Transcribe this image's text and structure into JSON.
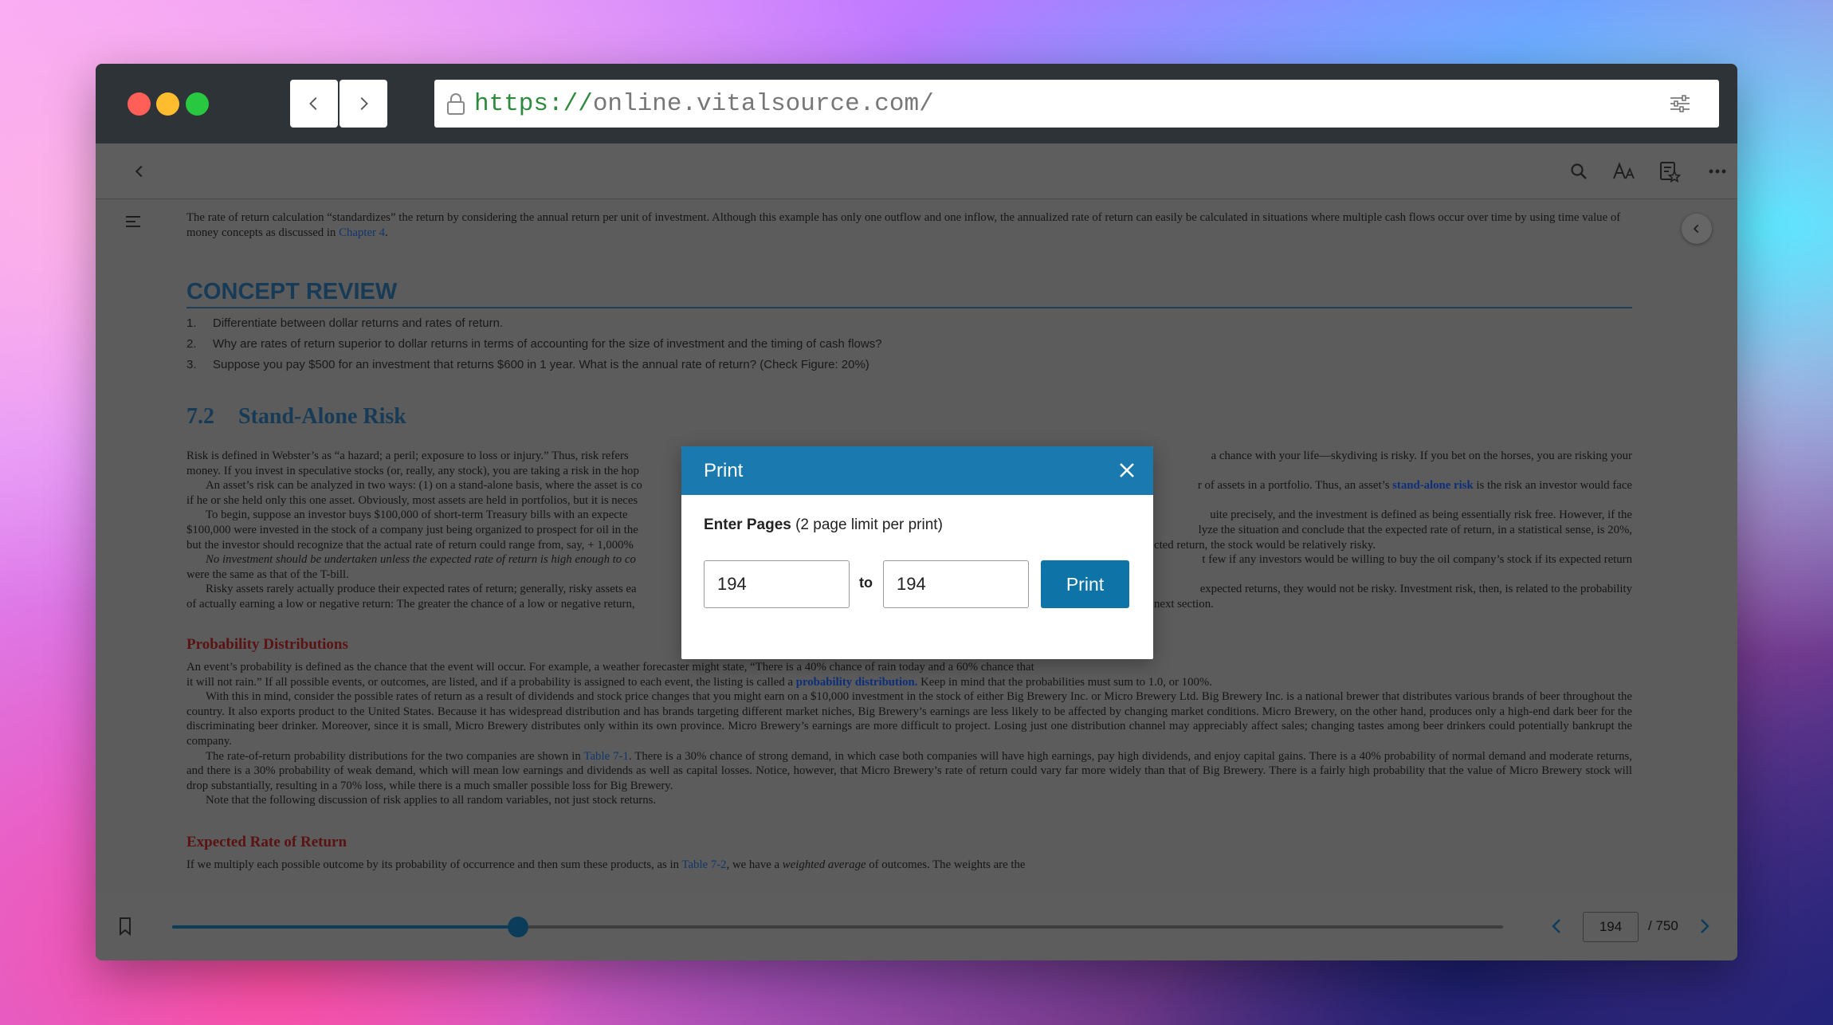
{
  "browser": {
    "url_scheme": "https://",
    "url_host": "online.vitalsource.com/",
    "traffic_colors": [
      "#ff5f57",
      "#febc2e",
      "#28c840"
    ]
  },
  "toolbar": {
    "icons": [
      "back-icon",
      "search-icon",
      "font-size-icon",
      "bookmarks-list-icon",
      "more-icon"
    ]
  },
  "book": {
    "intro_a": "The rate of return calculation “standardizes” the return by considering the annual return per unit of investment. Although this example has only one outflow and one inflow, the annualized rate of return can easily be calculated in situations where multiple cash flows occur over time by using time value of money concepts as discussed in ",
    "intro_link": "Chapter 4",
    "intro_b": ".",
    "concept_title": "CONCEPT REVIEW",
    "concept_items": [
      {
        "n": "1.",
        "text": "Differentiate between dollar returns and rates of return."
      },
      {
        "n": "2.",
        "text": "Why are rates of return superior to dollar returns in terms of accounting for the size of investment and the timing of cash flows?"
      },
      {
        "n": "3.",
        "text": "Suppose you pay $500 for an investment that returns $600 in 1 year. What is the annual rate of return? (Check Figure: 20%)"
      }
    ],
    "section_num": "7.2",
    "section_title": "Stand-Alone Risk",
    "risk_p1_left": "Risk is defined in Webster’s as “a hazard; a peril; exposure to loss or injury.” Thus, risk refers",
    "risk_p1_right": "a chance with your life—skydiving is risky. If you bet on the horses, you are risking your",
    "risk_p1_line2": "money. If you invest in speculative stocks (or, really, any stock), you are taking a risk in the hop",
    "risk_p2_left": "An asset’s risk can be analyzed in two ways: (1) on a stand-alone basis, where the asset is co",
    "risk_p2_right_a": "r of assets in a portfolio. Thus, an asset’s ",
    "risk_p2_link": "stand-alone risk",
    "risk_p2_right_b": " is the risk an investor would face",
    "risk_p2_line2": "if he or she held only this one asset. Obviously, most assets are held in portfolios, but it is neces",
    "risk_p3_left": "To begin, suppose an investor buys $100,000 of short-term Treasury bills with an expecte",
    "risk_p3_right": "uite precisely, and the investment is defined as being essentially risk free. However, if the",
    "risk_p3_line2_left": "$100,000 were invested in the stock of a company just being organized to prospect for oil in the",
    "risk_p3_line2_right": "lyze the situation and conclude that the expected rate of return, in a statistical sense, is 20%,",
    "risk_p3_line3_left": "but the investor should recognize that the actual rate of return could range from, say, + 1,000%",
    "risk_p3_line3_right": "cted return, the stock would be relatively risky.",
    "risk_p4_left": "No investment should be undertaken unless the expected rate of return is high enough to co",
    "risk_p4_right": "t few if any investors would be willing to buy the oil company’s stock if its expected return",
    "risk_p4_line2": "were the same as that of the T-bill.",
    "risk_p5_left": "Risky assets rarely actually produce their expected rates of return; generally, risky assets ea",
    "risk_p5_right": "expected returns, they would not be risky. Investment risk, then, is related to the probability",
    "risk_p5_line2_left": "of actually earning a low or negative return: The greater the chance of a low or negative return,",
    "risk_p5_line2_right": "next section.",
    "prob_title": "Probability Distributions",
    "prob_p1_a": "An event’s probability is defined as the chance that the event will occur. For example, a weather forecaster might state, “There is a 40% chance of rain today and a 60% chance that",
    "prob_p1_b": "it will not rain.” If all possible events, or outcomes, are listed, and if a probability is assigned to each event, the listing is called a ",
    "prob_p1_link": "probability distribution.",
    "prob_p1_c": " Keep in mind that the probabilities must sum to 1.0, or 100%.",
    "prob_p2": "With this in mind, consider the possible rates of return as a result of dividends and stock price changes that you might earn on a $10,000 investment in the stock of either Big Brewery Inc. or Micro Brewery Ltd. Big Brewery Inc. is a national brewer that distributes various brands of beer throughout the country. It also exports product to the United States. Because it has widespread distribution and has brands targeting different market niches, Big Brewery’s earnings are less likely to be affected by changing market conditions. Micro Brewery, on the other hand, produces only a high-end dark beer for the discriminating beer drinker. Moreover, since it is small, Micro Brewery distributes only within its own province. Micro Brewery’s earnings are more difficult to project. Losing just one distribution channel may appreciably affect sales; changing tastes among beer drinkers could potentially bankrupt the company.",
    "prob_p3_a": "The rate-of-return probability distributions for the two companies are shown in ",
    "prob_p3_link": "Table 7-1",
    "prob_p3_b": ". There is a 30% chance of strong demand, in which case both companies will have high earnings, pay high dividends, and enjoy capital gains. There is a 40% probability of normal demand and moderate returns, and there is a 30% probability of weak demand, which will mean low earnings and dividends as well as capital losses. Notice, however, that Micro Brewery’s rate of return could vary far more widely than that of Big Brewery. There is a fairly high probability that the value of Micro Brewery stock will drop substantially, resulting in a 70% loss, while there is a much smaller possible loss for Big Brewery.",
    "prob_p4": "Note that the following discussion of risk applies to all random variables, not just stock returns.",
    "exp_title": "Expected Rate of Return",
    "exp_p1_a": "If we multiply each possible outcome by its probability of occurrence and then sum these products, as in ",
    "exp_p1_link": "Table 7-2",
    "exp_p1_b": ", we have a ",
    "exp_p1_em": "weighted average",
    "exp_p1_c": " of outcomes. The weights are the"
  },
  "footer": {
    "progress_fraction": 0.26,
    "current_page": "194",
    "total_pages": "/ 750"
  },
  "print_dialog": {
    "title": "Print",
    "label_bold": "Enter Pages",
    "label_rest": " (2 page limit per print)",
    "from_value": "194",
    "to_label": "to",
    "to_value": "194",
    "button_label": "Print"
  }
}
